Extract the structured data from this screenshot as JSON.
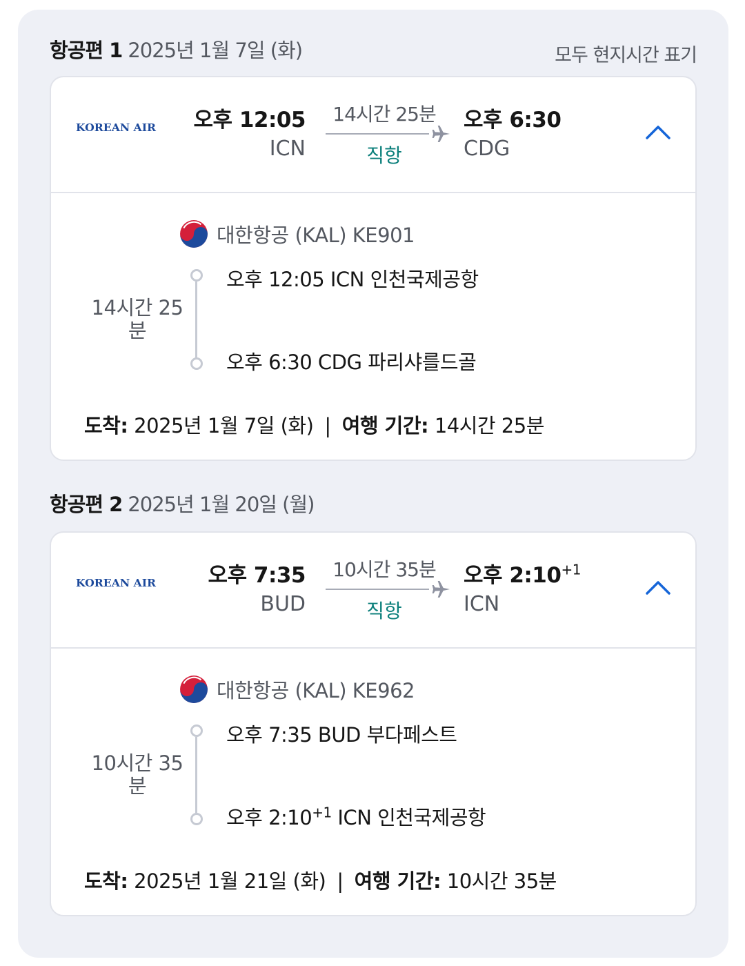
{
  "local_time_note": "모두 현지시간 표기",
  "legs": [
    {
      "label": "항공편 1",
      "date": "2025년 1월 7일 (화)",
      "airline_logo_text": "KOREAN AIR",
      "departure_time": "오후 12:05",
      "departure_code": "ICN",
      "duration": "14시간 25분",
      "stops": "직항",
      "arrival_time": "오후 6:30",
      "arrival_day_offset": "",
      "arrival_code": "CDG",
      "carrier": "대한항공 (KAL) KE901",
      "segment_duration": "14시간 25 분",
      "segment_departure": "오후 12:05 ICN 인천국제공항",
      "segment_arrival_time": "오후 6:30",
      "segment_arrival_rest": " CDG 파리샤를드골",
      "arrival_label": "도착:",
      "arrival_date": " 2025년 1월 7일 (화)",
      "trip_label": "여행 기간:",
      "trip_duration": " 14시간 25분"
    },
    {
      "label": "항공편 2",
      "date": "2025년 1월 20일 (월)",
      "airline_logo_text": "KOREAN AIR",
      "departure_time": "오후 7:35",
      "departure_code": "BUD",
      "duration": "10시간 35분",
      "stops": "직항",
      "arrival_time": "오후 2:10",
      "arrival_day_offset": "+1",
      "arrival_code": "ICN",
      "carrier": "대한항공 (KAL) KE962",
      "segment_duration": "10시간 35 분",
      "segment_departure": "오후 7:35 BUD 부다페스트",
      "segment_arrival_time": "오후 2:10",
      "segment_arrival_rest": " ICN 인천국제공항",
      "arrival_label": "도착:",
      "arrival_date": " 2025년 1월 21일 (화)",
      "trip_label": "여행 기간:",
      "trip_duration": " 10시간 35분"
    }
  ],
  "separator": "|",
  "colors": {
    "nonstop": "#0b7f7b",
    "accent": "#1565d8",
    "panel": "#eef0f6",
    "logo_blue": "#1d4a9c",
    "logo_red": "#d41f3a"
  },
  "icons": {
    "plane": "plane-icon",
    "collapse": "chevron-up-icon",
    "carrier": "korean-air-taegeuk-icon"
  }
}
